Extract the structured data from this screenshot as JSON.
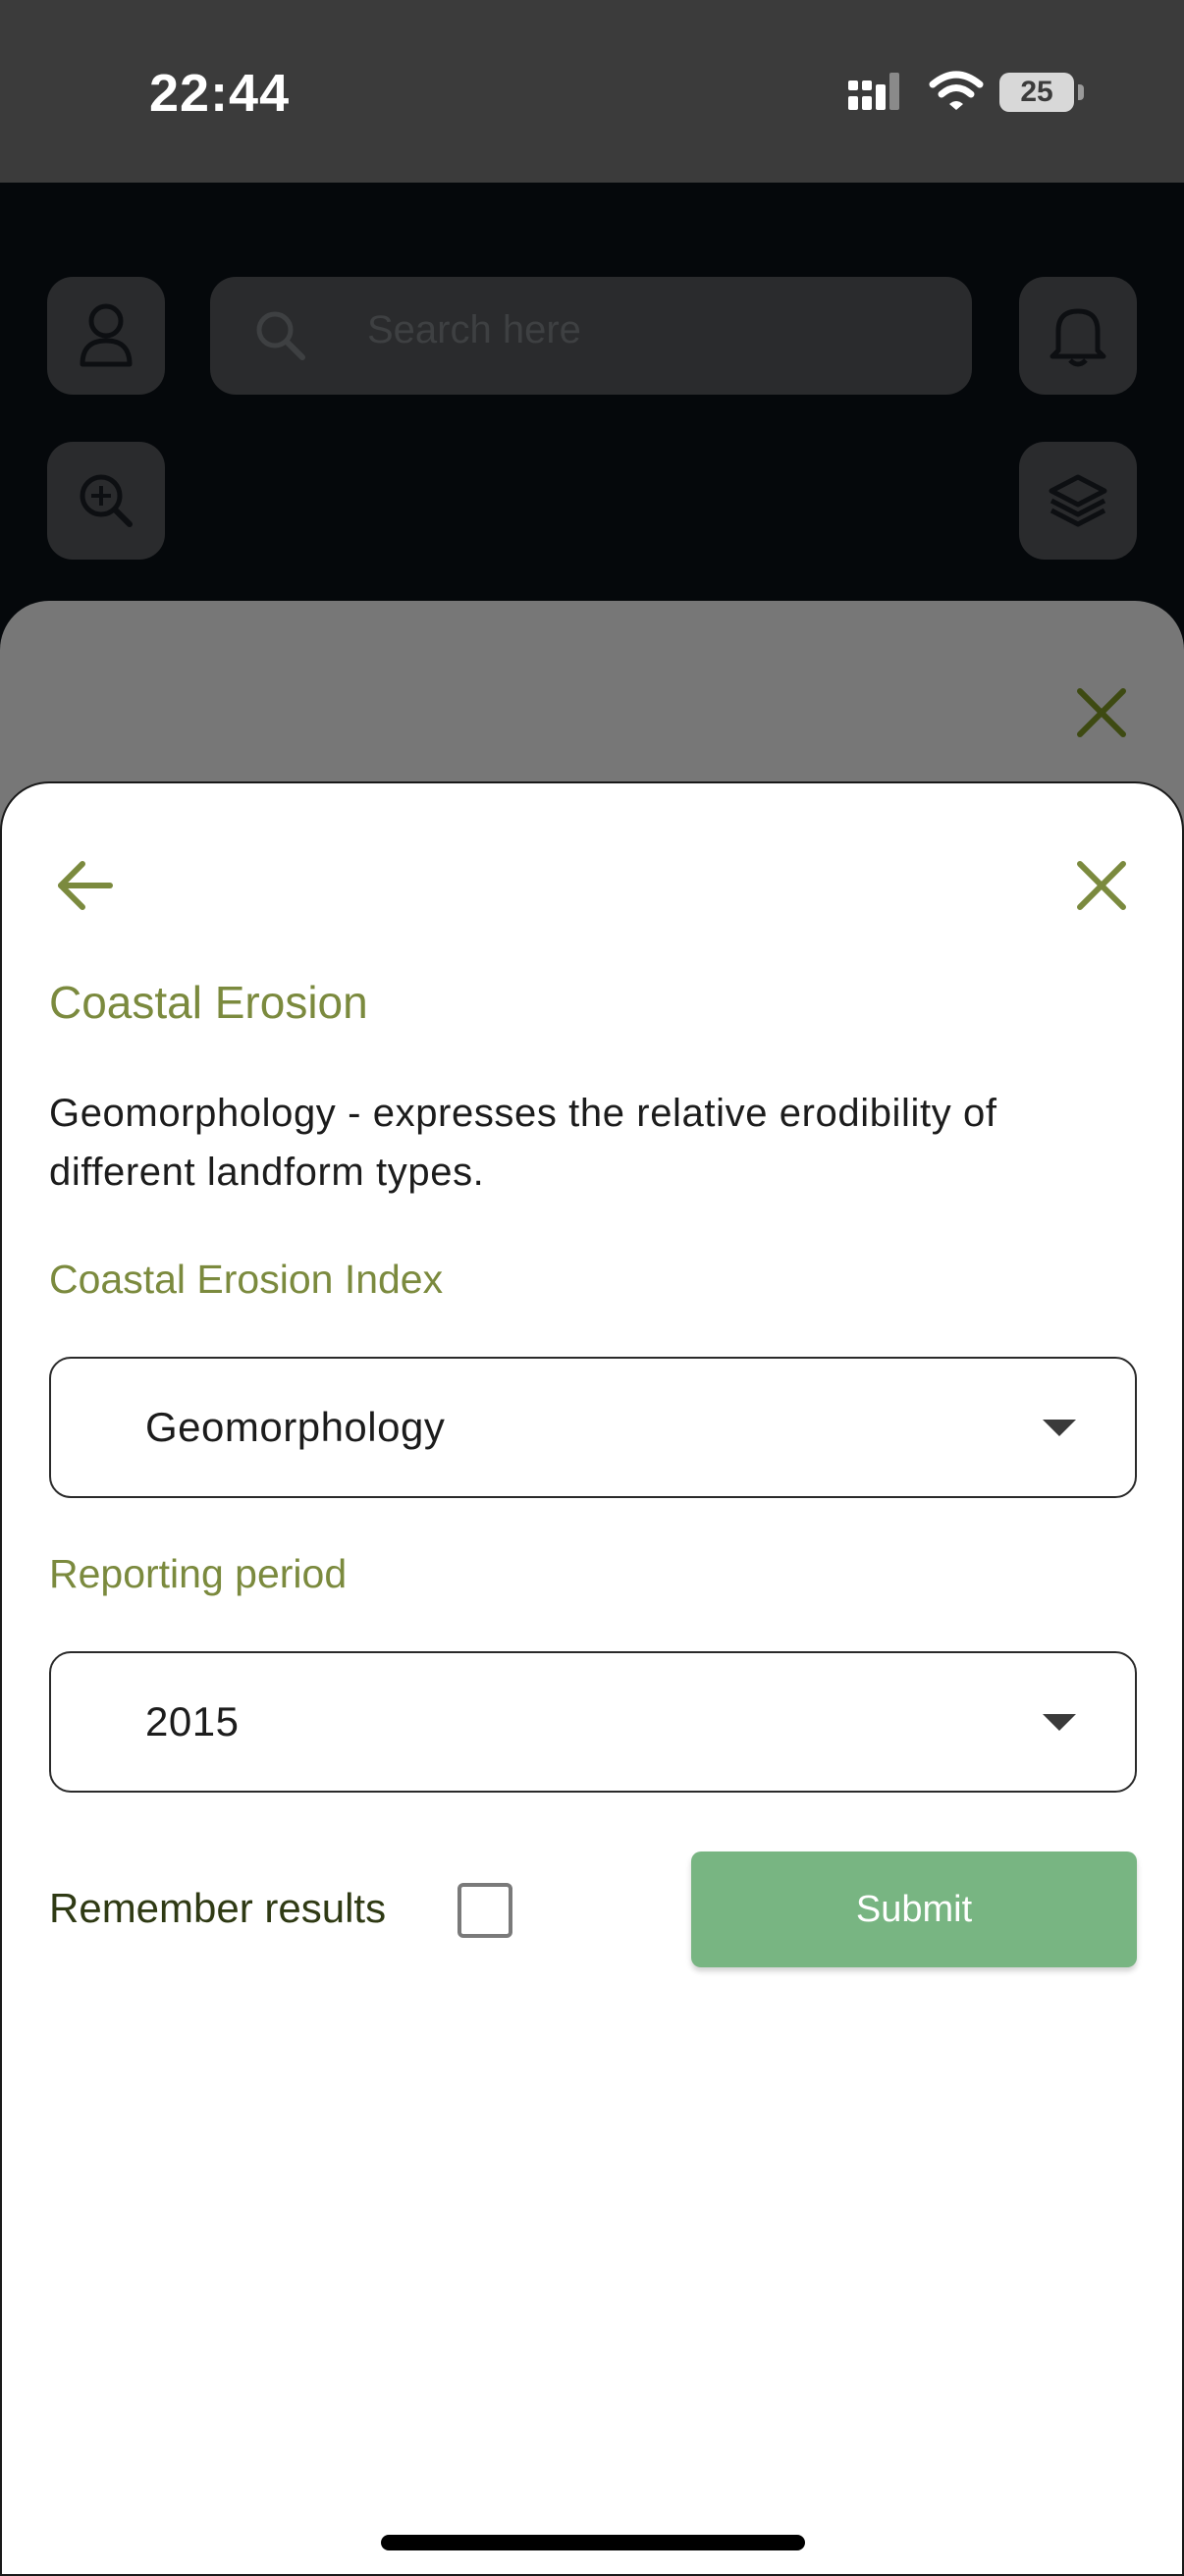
{
  "status_bar": {
    "time": "22:44",
    "battery": "25"
  },
  "map": {
    "search_placeholder": "Search here"
  },
  "sheet": {
    "title": "Coastal Erosion",
    "description": "Geomorphology - expresses the relative erodibility of different landform types.",
    "index_label": "Coastal Erosion Index",
    "index_value": "Geomorphology",
    "period_label": "Reporting period",
    "period_value": "2015",
    "remember_label": "Remember results",
    "remember_checked": false,
    "submit_label": "Submit"
  },
  "colors": {
    "accent_olive": "#7b8a3e",
    "submit_green": "#78b582",
    "status_bar_bg": "#3b3b3b"
  },
  "icons": [
    "user-icon",
    "search-icon",
    "bell-icon",
    "zoom-in-icon",
    "layers-icon",
    "back-arrow-icon",
    "close-icon",
    "caret-down-icon"
  ]
}
